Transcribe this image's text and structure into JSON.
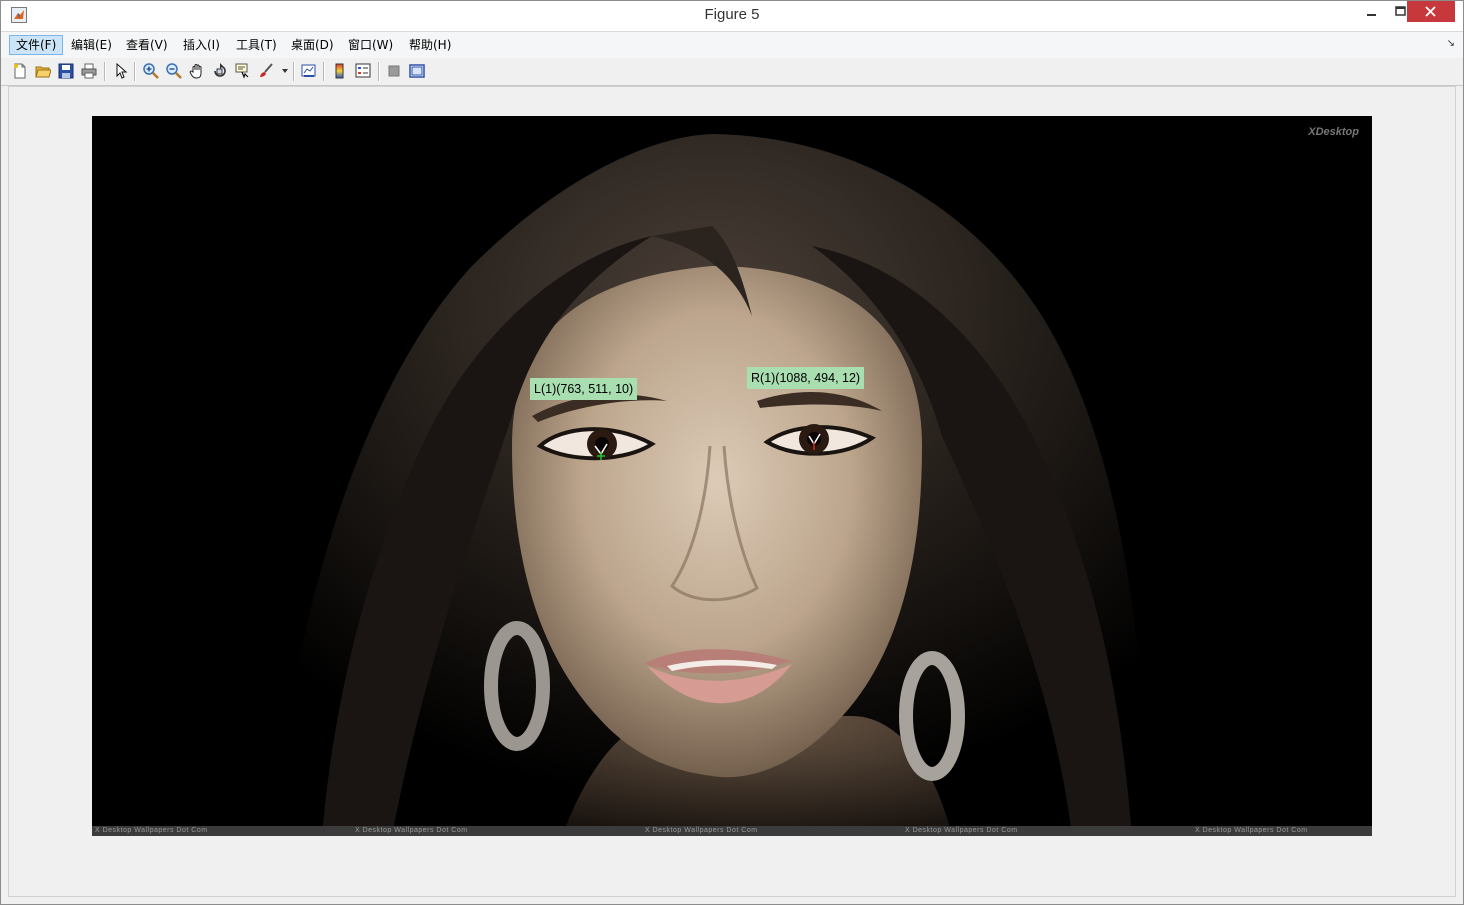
{
  "window": {
    "title": "Figure 5"
  },
  "menubar": {
    "items": [
      {
        "label": "文件(F)",
        "active": true
      },
      {
        "label": "编辑(E)"
      },
      {
        "label": "查看(V)"
      },
      {
        "label": "插入(I)"
      },
      {
        "label": "工具(T)"
      },
      {
        "label": "桌面(D)"
      },
      {
        "label": "窗口(W)"
      },
      {
        "label": "帮助(H)"
      }
    ],
    "corner_glyph": "↘"
  },
  "toolbar": {
    "icons": [
      "new-figure-icon",
      "open-file-icon",
      "save-figure-icon",
      "print-figure-icon",
      "edit-plot-icon",
      "zoom-in-icon",
      "zoom-out-icon",
      "pan-icon",
      "rotate-3d-icon",
      "data-cursor-icon",
      "brush-icon",
      "link-plot-icon",
      "insert-colorbar-icon",
      "insert-legend-icon",
      "hide-plot-tools-icon",
      "show-plot-tools-icon"
    ]
  },
  "figure": {
    "watermark_top": "XDesktop",
    "watermark_bottom": "X Desktop Wallpapers Dot Com",
    "annotations": {
      "left_eye": "L(1)(763, 511, 10)",
      "right_eye": "R(1)(1088, 494, 12)"
    },
    "marker_colors": {
      "left": "#22c12b",
      "right": "#d02a1a",
      "label_bg": "#a9deb0"
    }
  }
}
